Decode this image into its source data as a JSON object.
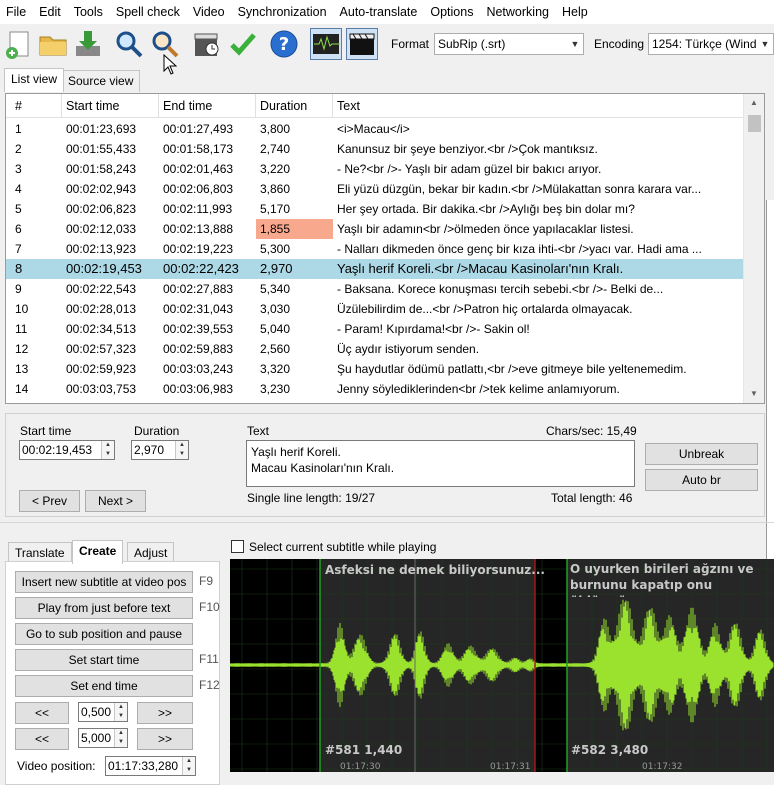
{
  "menu": [
    "File",
    "Edit",
    "Tools",
    "Spell check",
    "Video",
    "Synchronization",
    "Auto-translate",
    "Options",
    "Networking",
    "Help"
  ],
  "toolbar": {
    "format_label": "Format",
    "format_value": "SubRip (.srt)",
    "encoding_label": "Encoding",
    "encoding_value": "1254: Türkçe (Wind"
  },
  "tabs": [
    "List view",
    "Source view"
  ],
  "grid": {
    "columns": [
      "#",
      "Start time",
      "End time",
      "Duration",
      "Text"
    ],
    "rows": [
      [
        "1",
        "00:01:23,693",
        "00:01:27,493",
        "3,800",
        "<i>Macau</i>"
      ],
      [
        "2",
        "00:01:55,433",
        "00:01:58,173",
        "2,740",
        "Kanunsuz bir şeye benziyor.<br />Çok mantıksız."
      ],
      [
        "3",
        "00:01:58,243",
        "00:02:01,463",
        "3,220",
        "- Ne?<br />- Yaşlı bir adam güzel bir bakıcı arıyor."
      ],
      [
        "4",
        "00:02:02,943",
        "00:02:06,803",
        "3,860",
        "Eli yüzü düzgün, bekar bir kadın.<br />Mülakattan sonra karara var..."
      ],
      [
        "5",
        "00:02:06,823",
        "00:02:11,993",
        "5,170",
        "Her şey ortada. Bir dakika.<br />Aylığı beş bin dolar mı?"
      ],
      [
        "6",
        "00:02:12,033",
        "00:02:13,888",
        "1,855",
        "Yaşlı bir adamın<br />ölmeden önce yapılacaklar listesi."
      ],
      [
        "7",
        "00:02:13,923",
        "00:02:19,223",
        "5,300",
        "- Nalları dikmeden önce genç bir kıza ihti-<br />yacı var. Hadi ama ..."
      ],
      [
        "8",
        "00:02:19,453",
        "00:02:22,423",
        "2,970",
        "Yaşlı herif Koreli.<br />Macau Kasinoları'nın Kralı."
      ],
      [
        "9",
        "00:02:22,543",
        "00:02:27,883",
        "5,340",
        "- Baksana. Korece konuşması tercih sebebi.<br />- Belki de..."
      ],
      [
        "10",
        "00:02:28,013",
        "00:02:31,043",
        "3,030",
        "Üzülebilirdim de...<br />Patron hiç ortalarda olmayacak."
      ],
      [
        "11",
        "00:02:34,513",
        "00:02:39,553",
        "5,040",
        "- Param! Kıpırdama!<br />- Sakin ol!"
      ],
      [
        "12",
        "00:02:57,323",
        "00:02:59,883",
        "2,560",
        "Üç aydır istiyorum senden."
      ],
      [
        "13",
        "00:02:59,923",
        "00:03:03,243",
        "3,320",
        "Şu haydutlar ödümü patlattı,<br />eve gitmeye bile yeltenemedim."
      ],
      [
        "14",
        "00:03:03,753",
        "00:03:06,983",
        "3,230",
        "Jenny söylediklerinden<br />tek kelime anlamıyorum."
      ]
    ]
  },
  "editor": {
    "start_label": "Start time",
    "start_value": "00:02:19,453",
    "duration_label": "Duration",
    "duration_value": "2,970",
    "text_label": "Text",
    "chars_sec": "Chars/sec: 15,49",
    "line1": "Yaşlı herif Koreli.",
    "line2": "Macau Kasinoları'nın Kralı.",
    "single_line": "Single line length: 19/27",
    "total_length": "Total length: 46",
    "prev": "< Prev",
    "next": "Next >",
    "unbreak": "Unbreak",
    "auto_br": "Auto br"
  },
  "lower_tabs": [
    "Translate",
    "Create",
    "Adjust"
  ],
  "create": {
    "insert": "Insert new subtitle at video pos",
    "insert_key": "F9",
    "play": "Play from just before text",
    "play_key": "F10",
    "goto": "Go to sub position and pause",
    "set_start": "Set start time",
    "set_start_key": "F11",
    "set_end": "Set end time",
    "set_end_key": "F12",
    "back": "<<",
    "fwd": ">>",
    "step1": "0,500",
    "step2": "5,000",
    "video_pos_label": "Video position:",
    "video_pos_value": "01:17:33,280"
  },
  "waveform": {
    "checkbox_label": "Select current subtitle while playing",
    "sub1_text": "Asfeksi ne demek biliyorsunuz...",
    "sub2_text": "O uyurken birileri ağzını ve burnunu kapatıp onu öldürmüş.",
    "sub1_info": "#581  1,440",
    "sub2_info": "#582  3,480",
    "tick1": "01:17:30",
    "tick2": "01:17:31",
    "tick3": "01:17:32",
    "wave_color": "#9be22e"
  }
}
